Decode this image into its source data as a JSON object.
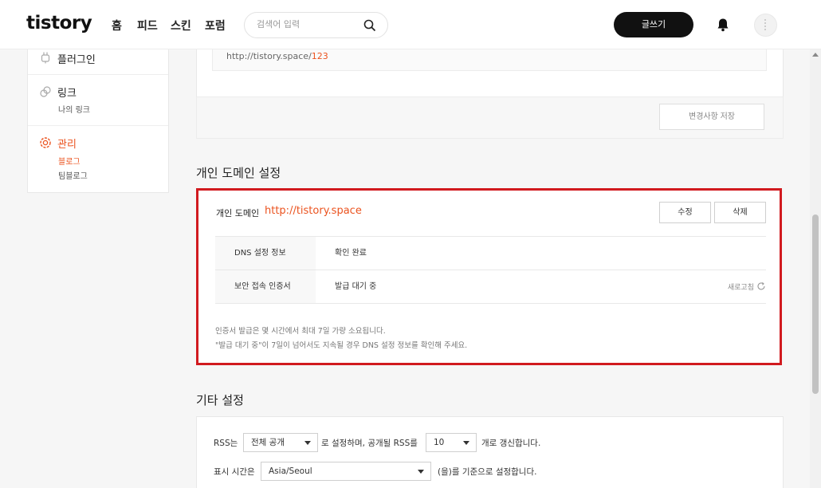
{
  "header": {
    "logo": "tistory",
    "nav": [
      "홈",
      "피드",
      "스킨",
      "포럼"
    ],
    "search_placeholder": "검색어 입력",
    "write_label": "글쓰기"
  },
  "sidebar": {
    "plugin_label": "플러그인",
    "link_label": "링크",
    "link_sub": "나의 링크",
    "manage_label": "관리",
    "manage_sub_blog": "블로그",
    "manage_sub_team": "팀블로그"
  },
  "top_section": {
    "url_prefix": "http://tistory.space/",
    "url_highlight": "123",
    "save_label": "변경사항 저장"
  },
  "domain_section": {
    "title": "개인 도메인 설정",
    "label": "개인 도메인",
    "url": "http://tistory.space",
    "edit_label": "수정",
    "delete_label": "삭제",
    "rows": [
      {
        "header": "DNS 설정 정보",
        "value": "확인 완료"
      },
      {
        "header": "보안 접속 인증서",
        "value": "발급 대기 중"
      }
    ],
    "refresh_label": "새로고침",
    "notice_1": "인증서 발급은 몇 시간에서 최대 7일 가량 소요됩니다.",
    "notice_2": "\"발급 대기 중\"이 7일이 넘어서도 지속될 경우 DNS 설정 정보를 확인해 주세요."
  },
  "other_section": {
    "title": "기타 설정",
    "rss_prefix": "RSS는",
    "rss_select": "전체 공개",
    "rss_middle": "로 설정하며, 공개될 RSS를",
    "rss_count": "10",
    "rss_suffix": "개로 갱신합니다.",
    "time_prefix": "표시 시간은",
    "time_select": "Asia/Seoul",
    "time_suffix": "(을)를 기준으로 설정합니다."
  },
  "colors": {
    "accent": "#eb531f",
    "highlight_border": "#d11a1f",
    "write_button": "#111111"
  }
}
